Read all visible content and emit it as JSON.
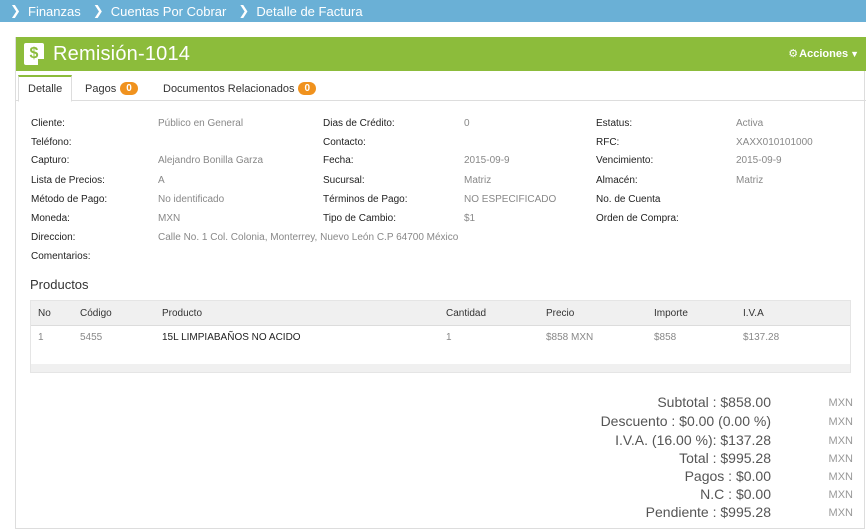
{
  "breadcrumb": [
    "Finanzas",
    "Cuentas Por Cobrar",
    "Detalle de Factura"
  ],
  "header": {
    "title": "Remisión-1014",
    "actions_label": "Acciones",
    "icon": "invoice-dollar-icon"
  },
  "tabs": [
    {
      "label": "Detalle",
      "active": true
    },
    {
      "label": "Pagos",
      "badge": "0"
    },
    {
      "label": "Documentos Relacionados",
      "badge": "0"
    }
  ],
  "details": {
    "cliente_label": "Cliente:",
    "cliente": "Público en General",
    "dias_label": "Dias de Crédito:",
    "dias": "0",
    "estatus_label": "Estatus:",
    "estatus": "Activa",
    "telefono_label": "Teléfono:",
    "contacto_label": "Contacto:",
    "rfc_label": "RFC:",
    "rfc": "XAXX010101000",
    "capturo_label": "Capturo:",
    "capturo": "Alejandro Bonilla Garza",
    "fecha_label": "Fecha:",
    "fecha": "2015-09-9",
    "vencimiento_label": "Vencimiento:",
    "vencimiento": "2015-09-9",
    "lista_label": "Lista de Precios:",
    "lista": "A",
    "sucursal_label": "Sucursal:",
    "sucursal": "Matriz",
    "almacen_label": "Almacén:",
    "almacen": "Matriz",
    "metodo_label": "Método de Pago:",
    "metodo": "No identificado",
    "terminos_label": "Términos de Pago:",
    "terminos": "NO ESPECIFICADO",
    "cuenta_label": "No. de Cuenta",
    "moneda_label": "Moneda:",
    "moneda": "MXN",
    "tipo_label": "Tipo de Cambio:",
    "tipo": "$1",
    "orden_label": "Orden de Compra:",
    "direccion_label": "Direccion:",
    "direccion": "Calle No. 1 Col. Colonia, Monterrey, Nuevo León C.P 64700 México",
    "comentarios_label": "Comentarios:"
  },
  "products": {
    "title": "Productos",
    "columns": [
      "No",
      "Código",
      "Producto",
      "Cantidad",
      "Precio",
      "Importe",
      "I.V.A"
    ],
    "rows": [
      [
        "1",
        "5455",
        "15L LIMPIABAÑOS NO ACIDO",
        "1",
        "$858 MXN",
        "$858",
        "$137.28"
      ]
    ]
  },
  "totals": [
    {
      "label": "Subtotal : $858.00",
      "currency": "MXN"
    },
    {
      "label": "Descuento : $0.00 (0.00 %)",
      "currency": "MXN"
    },
    {
      "label": "I.V.A. (16.00 %): $137.28",
      "currency": "MXN"
    },
    {
      "label": "Total : $995.28",
      "currency": "MXN"
    },
    {
      "label": "Pagos : $0.00",
      "currency": "MXN"
    },
    {
      "label": "N.C : $0.00",
      "currency": "MXN"
    },
    {
      "label": "Pendiente : $995.28",
      "currency": "MXN"
    }
  ],
  "colors": {
    "breadcrumb_bg": "#6ab0d6",
    "header_bg": "#8cbc3b",
    "badge": "#f0921e"
  }
}
